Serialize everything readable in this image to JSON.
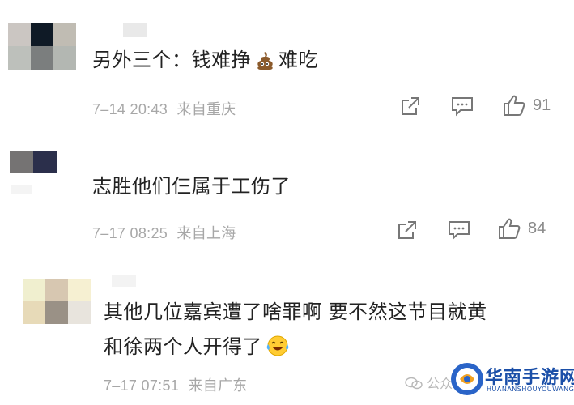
{
  "comments": [
    {
      "text_before": "另外三个：钱难挣",
      "text_after": "难吃",
      "emoji_icon": "poop-emoji",
      "timestamp": "7–14 20:43",
      "location": "来自重庆",
      "likes": "91",
      "avatar_colors": [
        "#cbc6c2",
        "#0f1a26",
        "#c0bcb3",
        "#bdc0bb",
        "#7b7e7e",
        "#b3b7b2"
      ]
    },
    {
      "text": "志胜他们仨属于工伤了",
      "timestamp": "7–17 08:25",
      "location": "来自上海",
      "likes": "84",
      "avatar_colors": [
        "#757373",
        "#2b2f4b"
      ]
    },
    {
      "line1": "其他几位嘉宾遭了啥罪啊 要不然这节目就黄",
      "line2": "和徐两个人开得了",
      "emoji_icon": "laughing-tears-emoji",
      "timestamp": "7–17 07:51",
      "location": "来自广东",
      "avatar_colors": [
        "#f0efcf",
        "#d7c7b1",
        "#f6f0d2",
        "#e7dab8",
        "#9a9186",
        "#e8e4dd"
      ]
    }
  ],
  "watermark": {
    "account": "公众号",
    "logo_text": "华南手游网",
    "logo_sub": "HUANANSHOUYOUWANG"
  }
}
